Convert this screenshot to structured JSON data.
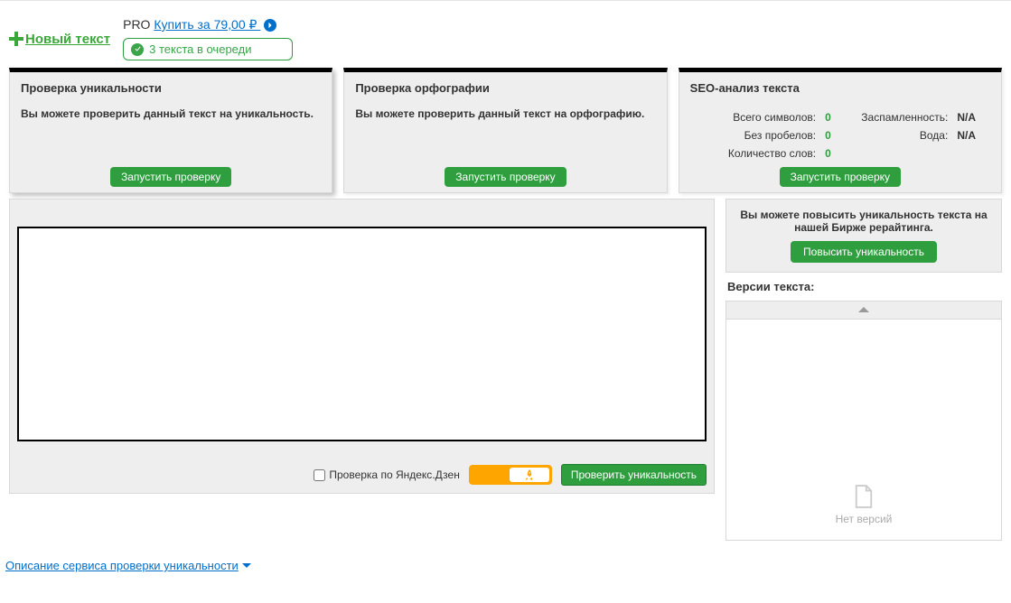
{
  "topbar": {
    "new_text": "Новый текст",
    "pro_label": "PRO",
    "buy_link": "Купить за 79,00",
    "currency": "₽",
    "queue_text": "3 текста в очереди"
  },
  "cards": {
    "unique": {
      "title": "Проверка уникальности",
      "desc": "Вы можете проверить данный текст на уникальность.",
      "button": "Запустить проверку"
    },
    "orth": {
      "title": "Проверка орфографии",
      "desc": "Вы можете проверить данный текст на орфографию.",
      "button": "Запустить проверку"
    },
    "seo": {
      "title": "SEO-анализ текста",
      "stats": {
        "total_label": "Всего символов:",
        "total_val": "0",
        "spam_label": "Заспамленность:",
        "spam_val": "N/A",
        "nospace_label": "Без пробелов:",
        "nospace_val": "0",
        "water_label": "Вода:",
        "water_val": "N/A",
        "words_label": "Количество слов:",
        "words_val": "0"
      },
      "button": "Запустить проверку"
    }
  },
  "editor": {
    "checkbox_label": "Проверка по Яндекс.Дзен",
    "check_button": "Проверить уникальность"
  },
  "right": {
    "boost_text": "Вы можете повысить уникальность текста на нашей Бирже рерайтинга.",
    "boost_button": "Повысить уникальность",
    "versions_title": "Версии текста:",
    "no_versions": "Нет версий"
  },
  "footer": {
    "link": "Описание сервиса проверки уникальности"
  }
}
